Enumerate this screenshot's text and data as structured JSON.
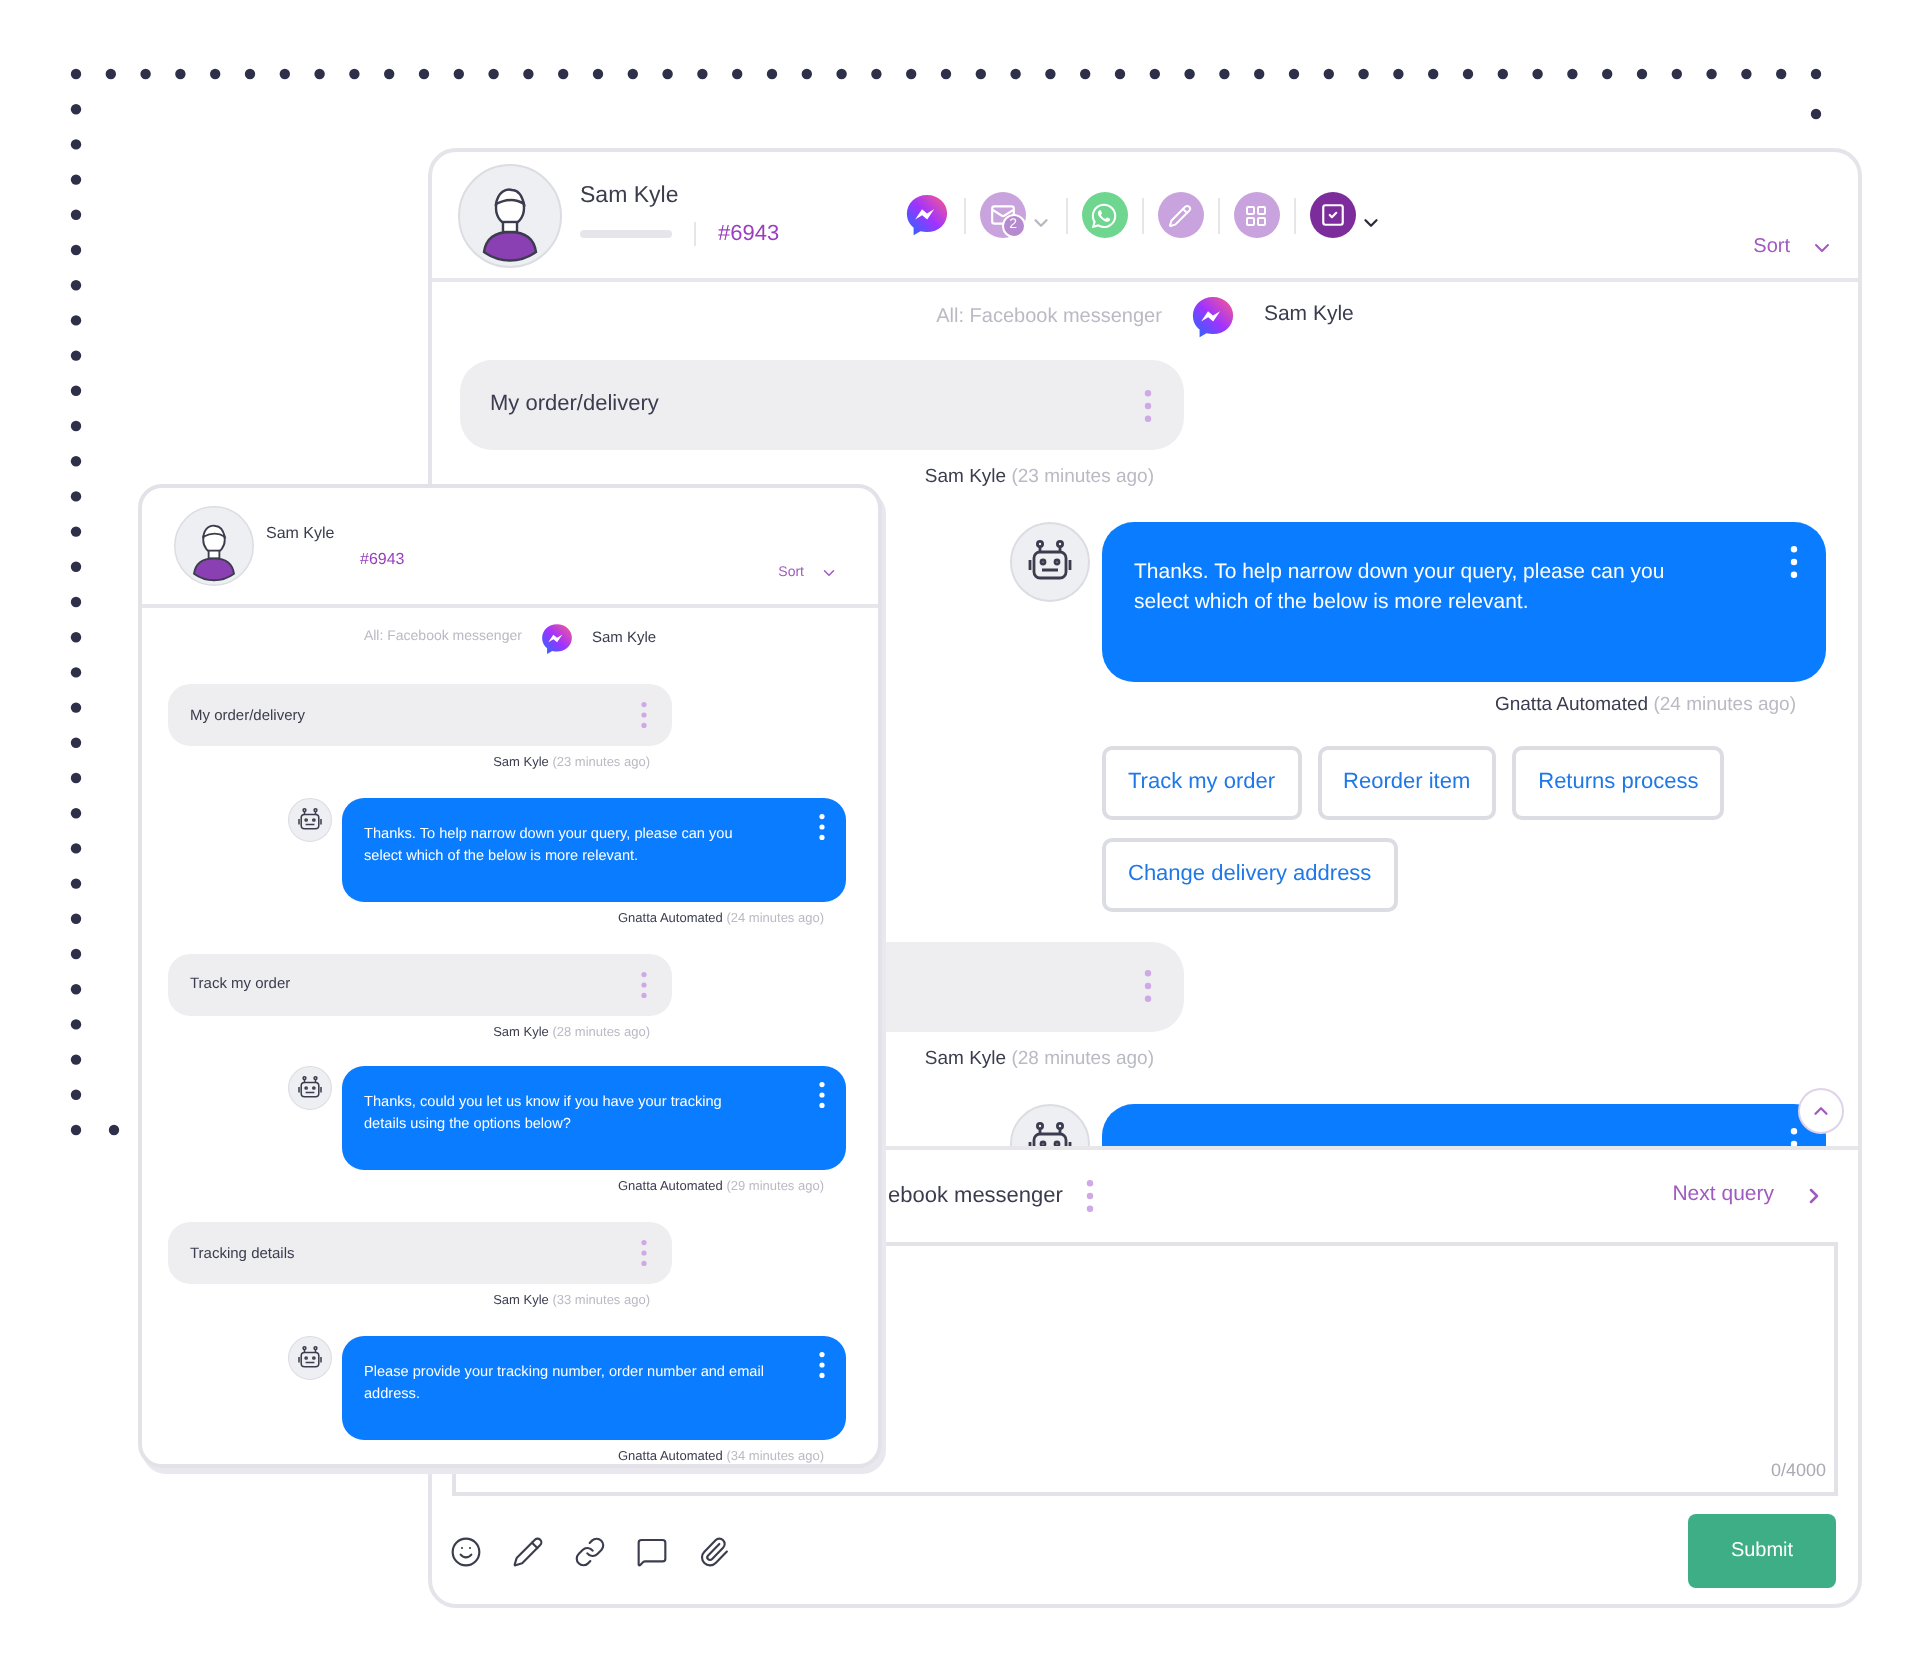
{
  "main_window": {
    "header": {
      "contact_name": "Sam Kyle",
      "ticket": "#6943",
      "channels": [
        {
          "kind": "messenger",
          "selected": false,
          "dropdown": false
        },
        {
          "kind": "email",
          "selected": false,
          "dropdown": true,
          "badge": "2"
        },
        {
          "kind": "whatsapp",
          "selected": false,
          "dropdown": false
        },
        {
          "kind": "note",
          "selected": false,
          "dropdown": false
        },
        {
          "kind": "apps",
          "selected": false,
          "dropdown": false
        },
        {
          "kind": "task",
          "selected": true,
          "dropdown": true
        }
      ],
      "sort": "Sort"
    },
    "conversation": {
      "channel_label": "All: Facebook messenger",
      "contact_name": "Sam Kyle",
      "messages": [
        {
          "kind": "customer",
          "text": "My order/delivery",
          "author": "Sam Kyle",
          "time": "(23 minutes ago)"
        },
        {
          "kind": "bot",
          "text": "Thanks. To help narrow down your query, please can you select which of the below is more relevant.",
          "author": "Gnatta Automated",
          "time": "(24 minutes ago)",
          "options": [
            "Track my order",
            "Reorder item",
            "Returns process",
            "Change delivery address"
          ]
        },
        {
          "kind": "customer",
          "author": "Sam Kyle",
          "time": "(28 minutes ago)"
        },
        {
          "kind": "bot"
        }
      ]
    },
    "composer": {
      "channel": "ebook messenger",
      "next_query": "Next query",
      "counter": "0/4000",
      "tools": [
        {
          "kind": "emoji"
        },
        {
          "kind": "signature"
        },
        {
          "kind": "link"
        },
        {
          "kind": "comment"
        },
        {
          "kind": "attachment"
        }
      ],
      "submit": "Submit"
    }
  },
  "popup_window": {
    "header": {
      "contact_name": "Sam Kyle",
      "ticket": "#6943",
      "sort": "Sort"
    },
    "conversation": {
      "channel_label": "All: Facebook messenger",
      "contact_name": "Sam Kyle",
      "messages": [
        {
          "kind": "customer",
          "text": "My order/delivery",
          "author": "Sam Kyle",
          "time": "(23 minutes ago)"
        },
        {
          "kind": "bot",
          "text": "Thanks. To help narrow down your query, please can you select which of the below is more relevant.",
          "author": "Gnatta Automated",
          "time": "(24 minutes ago)"
        },
        {
          "kind": "customer",
          "text": "Track my order",
          "author": "Sam Kyle",
          "time": "(28 minutes ago)"
        },
        {
          "kind": "bot",
          "text": "Thanks, could you let us know if you have your tracking details using the options below?",
          "author": "Gnatta Automated",
          "time": "(29 minutes ago)"
        },
        {
          "kind": "customer",
          "text": "Tracking details",
          "author": "Sam Kyle",
          "time": "(33 minutes ago)"
        },
        {
          "kind": "bot",
          "text": "Please provide your tracking number, order number and email address.",
          "author": "Gnatta Automated",
          "time": "(34 minutes ago)"
        }
      ]
    }
  }
}
